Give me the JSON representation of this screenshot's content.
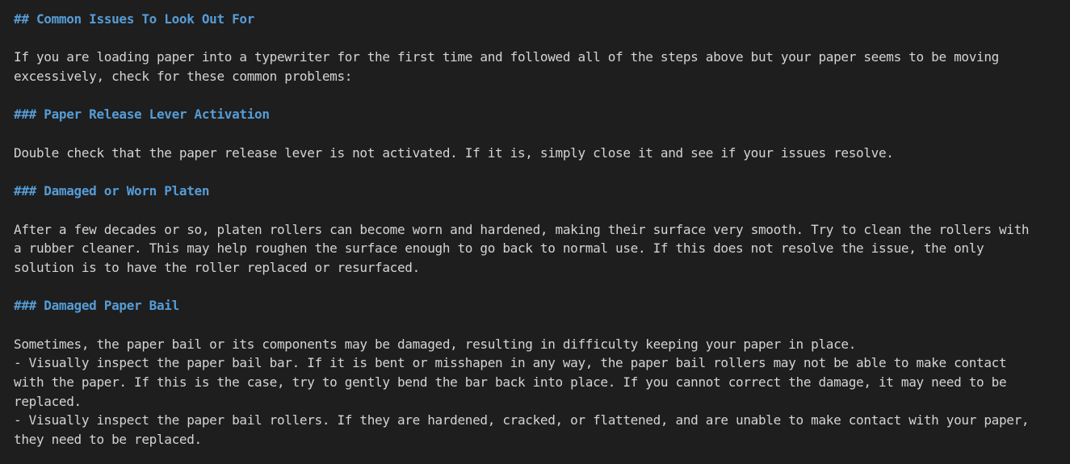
{
  "document": {
    "lines": [
      {
        "kind": "heading",
        "text": "## Common Issues To Look Out For"
      },
      {
        "kind": "blank",
        "text": ""
      },
      {
        "kind": "text",
        "text": "If you are loading paper into a typewriter for the first time and followed all of the steps above but your paper seems to be moving"
      },
      {
        "kind": "text",
        "text": "excessively, check for these common problems:"
      },
      {
        "kind": "blank",
        "text": ""
      },
      {
        "kind": "heading",
        "text": "### Paper Release Lever Activation"
      },
      {
        "kind": "blank",
        "text": ""
      },
      {
        "kind": "text",
        "text": "Double check that the paper release lever is not activated. If it is, simply close it and see if your issues resolve."
      },
      {
        "kind": "blank",
        "text": ""
      },
      {
        "kind": "heading",
        "text": "### Damaged or Worn Platen"
      },
      {
        "kind": "blank",
        "text": ""
      },
      {
        "kind": "text",
        "text": "After a few decades or so, platen rollers can become worn and hardened, making their surface very smooth. Try to clean the rollers with"
      },
      {
        "kind": "text",
        "text": "a rubber cleaner. This may help roughen the surface enough to go back to normal use. If this does not resolve the issue, the only"
      },
      {
        "kind": "text",
        "text": "solution is to have the roller replaced or resurfaced."
      },
      {
        "kind": "blank",
        "text": ""
      },
      {
        "kind": "heading",
        "text": "### Damaged Paper Bail"
      },
      {
        "kind": "blank",
        "text": ""
      },
      {
        "kind": "text",
        "text": "Sometimes, the paper bail or its components may be damaged, resulting in difficulty keeping your paper in place."
      },
      {
        "kind": "text",
        "text": "- Visually inspect the paper bail bar. If it is bent or misshapen in any way, the paper bail rollers may not be able to make contact"
      },
      {
        "kind": "text",
        "text": "with the paper. If this is the case, try to gently bend the bar back into place. If you cannot correct the damage, it may need to be"
      },
      {
        "kind": "text",
        "text": "replaced."
      },
      {
        "kind": "text",
        "text": "- Visually inspect the paper bail rollers. If they are hardened, cracked, or flattened, and are unable to make contact with your paper,"
      },
      {
        "kind": "text",
        "text": "they need to be replaced."
      }
    ]
  },
  "colors": {
    "background": "#1e1e1e",
    "text": "#d4d4d4",
    "heading": "#569cd6"
  }
}
